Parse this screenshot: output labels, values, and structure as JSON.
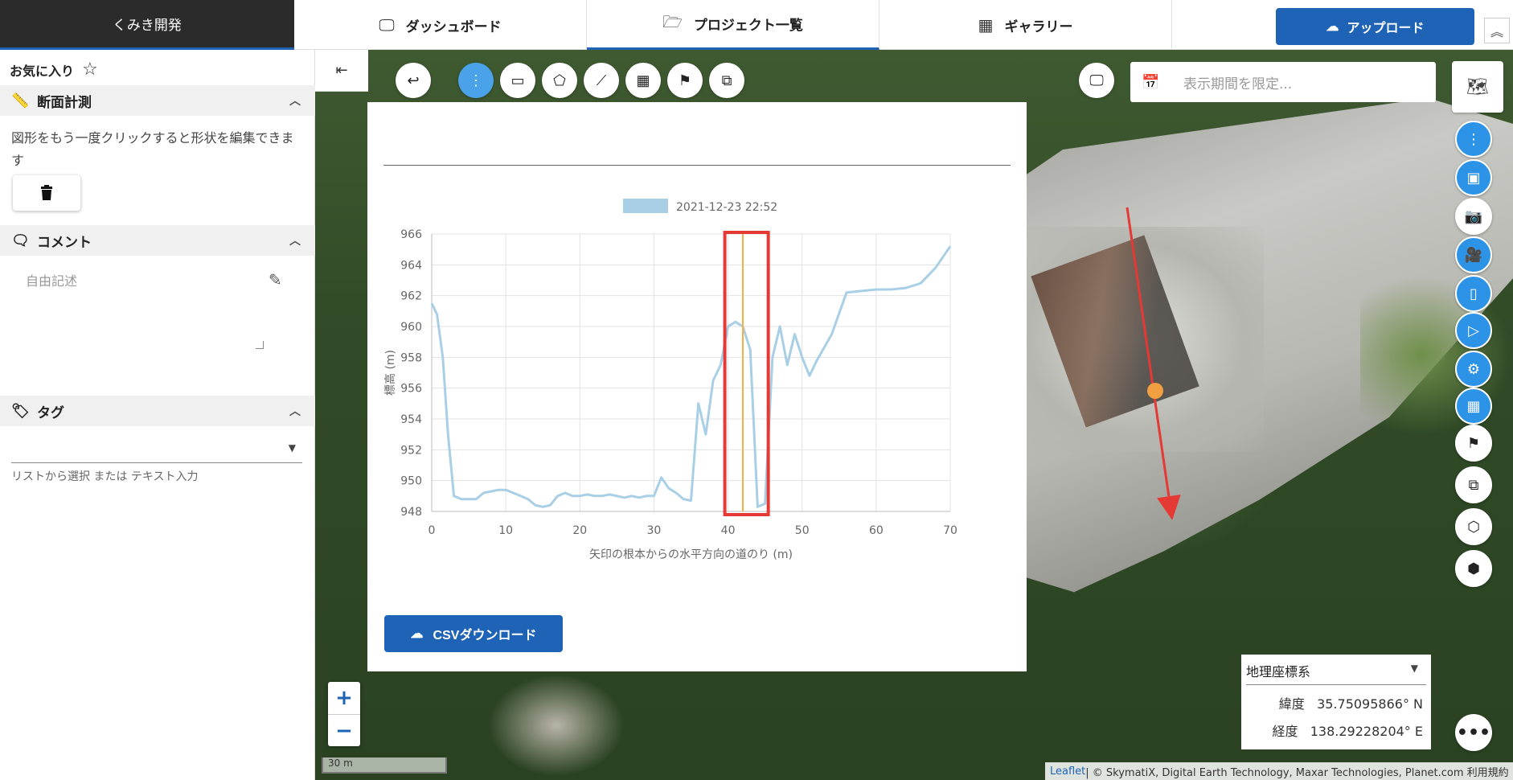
{
  "brand": "くみき開発",
  "nav": {
    "dashboard": "ダッシュボード",
    "projects": "プロジェクト一覧",
    "gallery": "ギャラリー",
    "upload": "アップロード"
  },
  "sidebar": {
    "favorite": "お気に入り",
    "measure": {
      "title": "断面計測",
      "text": "図形をもう一度クリックすると形状を編集できます"
    },
    "comment": {
      "title": "コメント",
      "placeholder": "自由記述"
    },
    "tag": {
      "title": "タグ",
      "help": "リストから選択 または テキスト入力"
    }
  },
  "map": {
    "period_placeholder": "表示期間を限定...",
    "csv_button": "CSVダウンロード",
    "scale": "30 m",
    "coord_system": "地理座標系",
    "latitude_label": "緯度",
    "latitude": "35.75095866° N",
    "longitude_label": "経度",
    "longitude": "138.29228204° E",
    "attribution_leaflet": "Leaflet",
    "attribution_rest": " | © SkymatiX, Digital Earth Technology, Maxar Technologies, Planet.com 利用規約"
  },
  "chart_data": {
    "type": "line",
    "legend": [
      "2021-12-23 22:52"
    ],
    "xlabel": "矢印の根本からの水平方向の道のり (m)",
    "ylabel": "標高 (m)",
    "xlim": [
      0,
      70
    ],
    "ylim": [
      948,
      966
    ],
    "xticks": [
      0,
      10,
      20,
      30,
      40,
      50,
      60,
      70
    ],
    "yticks": [
      948,
      950,
      952,
      954,
      956,
      958,
      960,
      962,
      964,
      966
    ],
    "grid": true,
    "series": [
      {
        "name": "2021-12-23 22:52",
        "color": "#a8cfe6",
        "x": [
          0,
          0.7,
          1.5,
          2.2,
          3,
          4,
          5,
          6,
          7,
          8,
          9,
          10,
          11,
          12,
          13,
          14,
          15,
          16,
          17,
          18,
          19,
          20,
          21,
          22,
          23,
          24,
          25,
          26,
          27,
          28,
          29,
          30,
          31,
          32,
          33,
          34,
          35,
          36,
          37,
          38,
          39,
          40,
          41,
          42,
          43,
          44,
          45,
          46,
          47,
          48,
          49,
          50,
          51,
          52,
          54,
          56,
          58,
          60,
          62,
          64,
          66,
          68,
          70
        ],
        "y": [
          961.5,
          960.8,
          958,
          953,
          949,
          948.8,
          948.8,
          948.8,
          949.2,
          949.3,
          949.4,
          949.4,
          949.2,
          949.0,
          948.8,
          948.4,
          948.3,
          948.4,
          949.0,
          949.2,
          949.0,
          949.0,
          949.1,
          949.0,
          949.0,
          949.1,
          949.0,
          948.9,
          949.0,
          948.9,
          949.0,
          949.0,
          950.2,
          949.5,
          949.2,
          948.8,
          948.7,
          955.0,
          953.0,
          956.5,
          957.5,
          960.0,
          960.3,
          960.0,
          958.5,
          948.3,
          948.5,
          958.0,
          960.0,
          957.5,
          959.5,
          958.0,
          956.8,
          957.8,
          959.5,
          962.2,
          962.3,
          962.4,
          962.4,
          962.5,
          962.8,
          963.8,
          965.2
        ]
      }
    ],
    "annotations": [
      {
        "type": "vertical-line",
        "x": 42,
        "color": "#f5b042"
      },
      {
        "type": "highlight-box",
        "x_range": [
          40,
          45
        ],
        "color": "#e53935"
      }
    ]
  }
}
